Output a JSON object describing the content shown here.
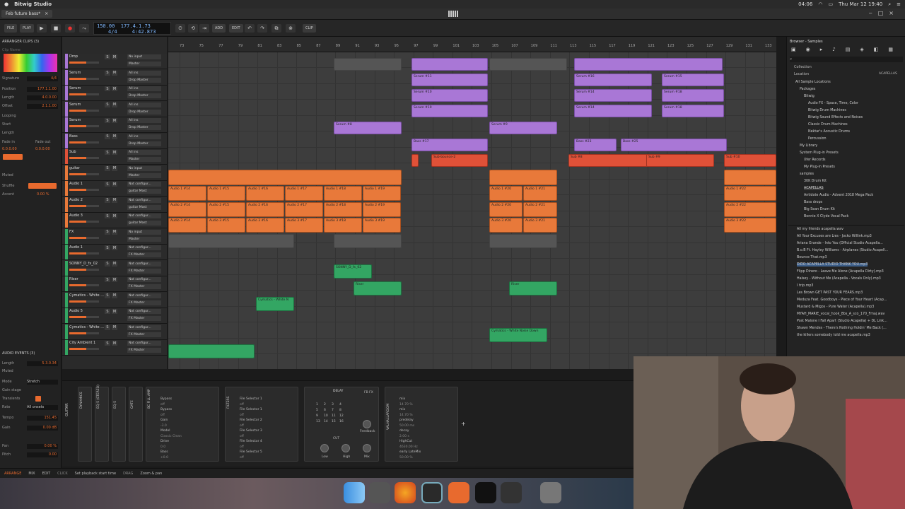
{
  "menubar": {
    "app_name": "Bitwig Studio",
    "right_items": [
      "04:06",
      "Thu Mar 12 19:40"
    ]
  },
  "tab": {
    "project_name": "Feb future bass*"
  },
  "toolbar": {
    "file": "FILE",
    "play": "PLAY",
    "tempo": "150.00",
    "signature": "4/4",
    "position": "177.4.1.73",
    "time": "4:42.873",
    "add": "ADD",
    "edit": "EDIT",
    "clip": "CLIP"
  },
  "inspector": {
    "header": "ARRANGER CLIPS (3)",
    "clip_name": "Clip Name",
    "signature_label": "Signature",
    "signature_value": "4/4",
    "position_label": "Position",
    "position_value": "177.1.1.00",
    "length_label": "Length",
    "length_value": "4.0.0.00",
    "offset_label": "Offset",
    "offset_value": "2.1.1.00",
    "looping_label": "Looping",
    "start_label": "Start",
    "length2_label": "Length",
    "fade_in_label": "Fade in",
    "fade_out_label": "Fade out",
    "fade_values": "0.0.0.00",
    "muted_label": "Muted",
    "shuffle_label": "Shuffle",
    "accent_label": "Accent",
    "accent_value": "0.00 %",
    "audio_events": "AUDIO EVENTS (3)",
    "ae_length_label": "Length",
    "ae_length_value": "5.3.0.34",
    "ae_muted": "Muted",
    "mode_label": "Mode",
    "mode_value": "Stretch",
    "gain_stage": "Gain stage",
    "transients": "Transients",
    "rate": "Rate",
    "rate_value": "All onsets",
    "tempo_label": "Tempo",
    "tempo_value": "151.45",
    "gain_label": "Gain",
    "gain_value": "0.00 dB",
    "pan_label": "Pan",
    "pan_value": "0.00 %",
    "pitch_label": "Pitch",
    "pitch_value": "0.00"
  },
  "tracks": [
    {
      "name": "Drop",
      "color": "#a977d6",
      "io1": "No input",
      "io2": "Master"
    },
    {
      "name": "Serum",
      "color": "#a977d6",
      "io1": "All ins",
      "io2": "Drop Master"
    },
    {
      "name": "Serum",
      "color": "#a977d6",
      "io1": "All ins",
      "io2": "Drop Master"
    },
    {
      "name": "Serum",
      "color": "#a977d6",
      "io1": "All ins",
      "io2": "Drop Master"
    },
    {
      "name": "Serum",
      "color": "#a977d6",
      "io1": "All ins",
      "io2": "Drop Master"
    },
    {
      "name": "Bass",
      "color": "#a977d6",
      "io1": "All ins",
      "io2": "Drop Master"
    },
    {
      "name": "Sub",
      "color": "#e05138",
      "io1": "All ins",
      "io2": "Master"
    },
    {
      "name": "guitar",
      "color": "#e8793a",
      "io1": "No input",
      "io2": "Master"
    },
    {
      "name": "Audio 1",
      "color": "#e8793a",
      "io1": "Not configur...",
      "io2": "guitar Mast"
    },
    {
      "name": "Audio 2",
      "color": "#e8793a",
      "io1": "Not configur...",
      "io2": "guitar Mast"
    },
    {
      "name": "Audio 3",
      "color": "#e8793a",
      "io1": "Not configur...",
      "io2": "guitar Mast"
    },
    {
      "name": "FX",
      "color": "#33a663",
      "io1": "No input",
      "io2": "Master"
    },
    {
      "name": "Audio 1",
      "color": "#33a663",
      "io1": "Not configur...",
      "io2": "FX Master"
    },
    {
      "name": "SONNY_D_fx_02",
      "color": "#33a663",
      "io1": "Not configur...",
      "io2": "FX Master"
    },
    {
      "name": "Riser",
      "color": "#33a663",
      "io1": "Not configur...",
      "io2": "FX Master"
    },
    {
      "name": "Cymatics - White ...",
      "color": "#33a663",
      "io1": "Not configur...",
      "io2": "FX Master"
    },
    {
      "name": "Audio 5",
      "color": "#33a663",
      "io1": "Not configur...",
      "io2": "FX Master"
    },
    {
      "name": "Cymatics - White ...",
      "color": "#33a663",
      "io1": "Not configur...",
      "io2": "FX Master"
    },
    {
      "name": "City Ambient 1",
      "color": "#33a663",
      "io1": "Not configur...",
      "io2": "FX Master"
    }
  ],
  "ruler": [
    "73",
    "75",
    "77",
    "79",
    "81",
    "83",
    "85",
    "87",
    "89",
    "91",
    "93",
    "95",
    "97",
    "99",
    "101",
    "103",
    "105",
    "107",
    "109",
    "111",
    "113",
    "115",
    "117",
    "119",
    "121",
    "123",
    "125",
    "127",
    "129",
    "131",
    "133"
  ],
  "clips": {
    "serum11": "Serum #11",
    "serum10": "Serum #10",
    "serum10b": "Serum #10",
    "serum8": "Serum #8",
    "serum9": "Serum #9",
    "serum16": "Serum #16",
    "serum14": "Serum #14",
    "serum14b": "Serum #14",
    "serum15": "Serum #15",
    "serum18": "Serum #18",
    "serum18b": "Serum #18",
    "bass17": "Bass #17",
    "bass25": "Bass #25",
    "bass23": "Bass #23",
    "sub3": "Sub-bounce-2",
    "sub8": "Sub #8",
    "sub9": "Sub #9",
    "sub10": "Sub #10",
    "a1_14": "Audio 1 #14",
    "a1_15": "Audio 1 #15",
    "a1_16": "Audio 1 #16",
    "a1_17": "Audio 1 #17",
    "a1_18": "Audio 1 #18",
    "a1_19": "Audio 1 #19",
    "a1_20": "Audio 1 #20",
    "a1_21": "Audio 1 #21",
    "a1_22": "Audio 1 #22",
    "a2_14": "Audio 2 #14",
    "a2_15": "Audio 2 #15",
    "a2_16": "Audio 2 #16",
    "a2_17": "Audio 2 #17",
    "a2_18": "Audio 2 #18",
    "a2_19": "Audio 2 #19",
    "a2_20": "Audio 2 #20",
    "a2_21": "Audio 2 #21",
    "a2_22": "Audio 2 #22",
    "a3_14": "Audio 3 #14",
    "a3_15": "Audio 3 #15",
    "a3_16": "Audio 3 #16",
    "a3_17": "Audio 3 #17",
    "a3_18": "Audio 3 #18",
    "a3_19": "Audio 3 #19",
    "a3_20": "Audio 3 #20",
    "a3_21": "Audio 3 #21",
    "a3_22": "Audio 3 #22",
    "sonny": "SONNY_D_fx_02",
    "riser1": "Riser",
    "riser2": "Riser",
    "cym1": "Cymatics - White N",
    "cym2": "Cymatics - White Noise Down"
  },
  "browser": {
    "title": "Browser - Samples",
    "collection": "Collection",
    "location": "Location",
    "acapellas_tag": "ACAPELLAS",
    "items": [
      "All Sample Locations",
      "Packages",
      "Bitwig",
      "Audio FX - Space, Time, Color",
      "Bitwig Drum Machines",
      "Bitwig Sound Effects and Noises",
      "Classic Drum Machines",
      "Nektar's Acoustic Drums",
      "Percussion",
      "My Library",
      "System Plug-in Presets",
      "Xfer Records",
      "My Plug-in Presets",
      "samples",
      "30K Drum Kit",
      "ACAPELLAS",
      "Antidote Audio - Advent 2018 Mega Pack",
      "Bass drops",
      "Big Sean Drum Kit",
      "Bonnie X Clyde Vocal Pack"
    ],
    "files": [
      "All my friends acapella.wav",
      "All Your Excuses are Lies - Jocko Willink.mp3",
      "Ariana Grande - Into You (Official Studio Acapella...",
      "B.o.B Ft. Hayley Williams - Airplanes (Studio Acapell...",
      "Bounce That.mp3",
      "DIDO ACAPELLA STUDIO THANK YOU.mp3",
      "Flipp Dinero - Leave Me Alone (Acapella Dirty).mp3",
      "Halsey - Without Me (Acapella - Vocals Only).mp3",
      "I trip.mp3",
      "Les Brown GET PAST YOUR FEARS.mp3",
      "Meduza Feat. Goodboys - Piece of Your Heart (Acap...",
      "Mustard & Migos - Pure Water (Acapella).mp3",
      "MYAH_MARIE_vocal_hook_8bs_A_sco_170_Fmaj.wav",
      "Post Malone I Fall Apart (Studio Acapella) + DL Link...",
      "Shawn Mendes - There's Nothing Holdin' Me Back (...",
      "the killers somebody told me acapella.mp3"
    ]
  },
  "devices": {
    "guitar": "GUITAR",
    "dynamics": "DYNAMICS",
    "eq": "EQ-5 (STEREO)",
    "eq5": "EQ-5",
    "gate": "GATE",
    "amp": "BC FILL AMP",
    "amp_items": [
      "Bypass",
      "off",
      "Bypass",
      "off",
      "Gain",
      "-3.0",
      "Model",
      "Classic Clean",
      "Drive",
      "0.0",
      "Bass",
      "+0.0"
    ],
    "filters_label": "FILTERS",
    "filters": [
      "File Selector 1",
      "off",
      "File Selector 1",
      "off",
      "File Selector 2",
      "off",
      "File Selector 3",
      "off",
      "File Selector 4",
      "off",
      "File Selector 5",
      "off"
    ],
    "delay": "DELAY",
    "delay_fx": "FB FX",
    "delay_grid": [
      "1",
      "2",
      "3",
      "4",
      "5",
      "6",
      "7",
      "8",
      "9",
      "10",
      "11",
      "12",
      "13",
      "14",
      "15",
      "16"
    ],
    "cut": "CUT",
    "feedback": "Feedback",
    "low": "Low",
    "high": "High",
    "mix": "Mix",
    "reverb": "VALHALLAROOM",
    "reverb_items": [
      "mix",
      "14.70 %",
      "mix",
      "14.70 %",
      "predelay",
      "50.00 ms",
      "decay",
      "2.00 s",
      "HighCut",
      "4630.00 Hz",
      "early LateMix",
      "50.00 %"
    ]
  },
  "status": {
    "arrange": "ARRANGE",
    "mix": "MIX",
    "edit": "EDIT",
    "click": "CLICK",
    "click_action": "Set playback start time",
    "drag": "DRAG",
    "drag_action": "Zoom & pan"
  }
}
